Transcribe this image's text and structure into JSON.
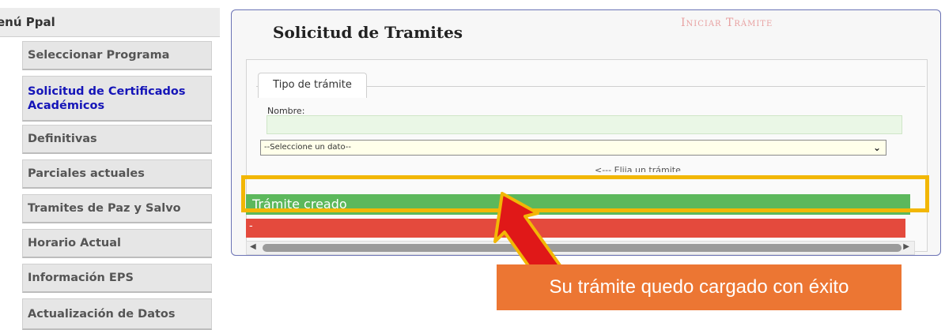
{
  "sidebar": {
    "header": "enú Ppal",
    "items": [
      {
        "label": "Seleccionar Programa"
      },
      {
        "label": "Solicitud de Certificados Académicos"
      },
      {
        "label": "Definitivas"
      },
      {
        "label": "Parciales actuales"
      },
      {
        "label": "Tramites de Paz y Salvo"
      },
      {
        "label": "Horario Actual"
      },
      {
        "label": "Información EPS"
      },
      {
        "label": "Actualización de Datos"
      }
    ]
  },
  "panel": {
    "title": "Solicitud de Tramites",
    "action_label": "Iniciar Trámite",
    "tab_label": "Tipo de trámite",
    "name_label": "Nombre:",
    "name_value": "",
    "select_value": "--Seleccione un dato--",
    "hint": "<--- Elija un trámite",
    "success_message": "Trámite creado",
    "error_message": "-"
  },
  "callout": {
    "text": "Su trámite quedo cargado con éxito"
  },
  "colors": {
    "success": "#5cb85c",
    "error": "#e44a3d",
    "highlight": "#f2b705",
    "callout": "#ec7633",
    "arrow": "#e01818",
    "active_link": "#1515b8"
  }
}
